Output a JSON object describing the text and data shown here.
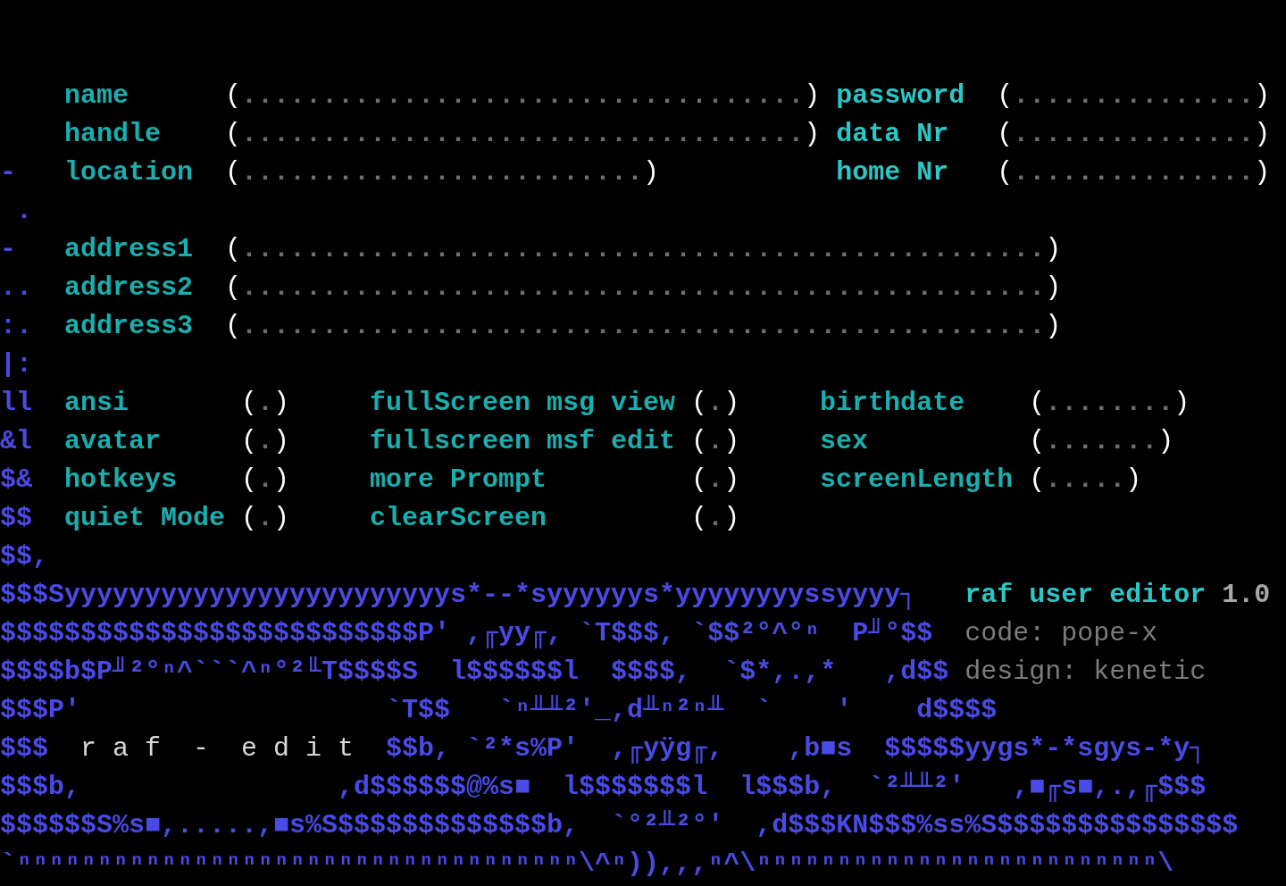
{
  "user_fields": [
    {
      "label": "name",
      "open": "(",
      "value": "...................................",
      "close": ")"
    },
    {
      "label": "handle",
      "open": "(",
      "value": "...................................",
      "close": ")"
    },
    {
      "label": "location",
      "open": "(",
      "value": ".........................",
      "close": ")"
    }
  ],
  "contact_fields": [
    {
      "label": "password",
      "open": "(",
      "value": "...............",
      "close": ")"
    },
    {
      "label": "data Nr",
      "open": "(",
      "value": "...............",
      "close": ")"
    },
    {
      "label": "home Nr",
      "open": "(",
      "value": "...............",
      "close": ")"
    }
  ],
  "address_fields": [
    {
      "label": "address1",
      "open": "(",
      "value": "..................................................",
      "close": ")"
    },
    {
      "label": "address2",
      "open": "(",
      "value": "..................................................",
      "close": ")"
    },
    {
      "label": "address3",
      "open": "(",
      "value": "..................................................",
      "close": ")"
    }
  ],
  "toggles_left": [
    {
      "label": "ansi",
      "open": "(",
      "mark": ".",
      "close": ")"
    },
    {
      "label": "avatar",
      "open": "(",
      "mark": ".",
      "close": ")"
    },
    {
      "label": "hotkeys",
      "open": "(",
      "mark": ".",
      "close": ")"
    },
    {
      "label": "quiet Mode",
      "open": "(",
      "mark": ".",
      "close": ")"
    }
  ],
  "toggles_middle": [
    {
      "label": "fullScreen msg view",
      "open": "(",
      "mark": ".",
      "close": ")"
    },
    {
      "label": "fullscreen msf edit",
      "open": "(",
      "mark": ".",
      "close": ")"
    },
    {
      "label": "more Prompt",
      "open": "(",
      "mark": ".",
      "close": ")"
    },
    {
      "label": "clearScreen",
      "open": "(",
      "mark": ".",
      "close": ")"
    }
  ],
  "profile_fields": [
    {
      "label": "birthdate",
      "open": "(",
      "value": "........",
      "close": ")"
    },
    {
      "label": "sex",
      "open": "(",
      "value": ".......",
      "close": ")"
    },
    {
      "label": "screenLength",
      "open": "(",
      "value": ".....",
      "close": ")"
    }
  ],
  "margin_art": [
    "-",
    " .",
    "-",
    "..",
    ":.",
    "|:",
    "ll",
    "&l",
    "$&",
    "$$"
  ],
  "art_lines": [
    [
      {
        "kind": "art",
        "text": "$$,"
      }
    ],
    [
      {
        "kind": "art",
        "text": "$$$Syyyyyyyyyyyyyyyyyyyyyyyys*--*syyyyyys*yyyyyyyyssyyyy┐"
      }
    ],
    [
      {
        "kind": "art",
        "text": "$$$$$$$$$$$$$$$$$$$$$$$$$$P' ,╓yy╓, `T$$$, `$$²°^°ⁿ  P╜°$$"
      }
    ],
    [
      {
        "kind": "art",
        "text": "$$$$b$P╜²°ⁿ^```^ⁿ°²╙T$$$$S  l$$$$$$l  $$$$,  `$*,.,*   ,d$$"
      }
    ],
    [
      {
        "kind": "art",
        "text": "$$$P'                   `T$$   `ⁿ╨╨²'_,d╨ⁿ²ⁿ╨  `    '    d$$$$"
      }
    ],
    [
      {
        "kind": "art",
        "text": "$$$  "
      },
      {
        "kind": "title",
        "text": "r a f  -  e d i t"
      },
      {
        "kind": "art",
        "text": "  $$b, `²*s%P'  ,╓yÿg╓,    ,b■s  $$$$$yygs*-*sgys-*y┐"
      }
    ],
    [
      {
        "kind": "art",
        "text": "$$$b,                ,d$$$$$$@%s■  l$$$$$$$l  l$$$b,  `²╨╨²'   ,■╓s■,.,╓$$$"
      }
    ],
    [
      {
        "kind": "art",
        "text": "$$$$$$S%s■,.....,■s%S$$$$$$$$$$$$$b,  `°²╨²°'  ,d$$$KN$$$%ss%S$$$$$$$$$$$$$$$"
      }
    ],
    [
      {
        "kind": "art",
        "text": "`ⁿⁿⁿⁿⁿⁿⁿⁿⁿⁿⁿⁿⁿⁿⁿⁿⁿⁿⁿⁿⁿⁿⁿⁿⁿⁿⁿⁿⁿⁿⁿⁿⁿⁿⁿ\\^ⁿ)),,,ⁿ^\\ⁿⁿⁿⁿⁿⁿⁿⁿⁿⁿⁿⁿⁿⁿⁿⁿⁿⁿⁿⁿⁿⁿⁿⁿⁿ\\"
      }
    ]
  ],
  "credits": {
    "title": "raf user editor",
    "version": "1.0",
    "lines": [
      "code: pope-x",
      "design: kenetic"
    ]
  }
}
